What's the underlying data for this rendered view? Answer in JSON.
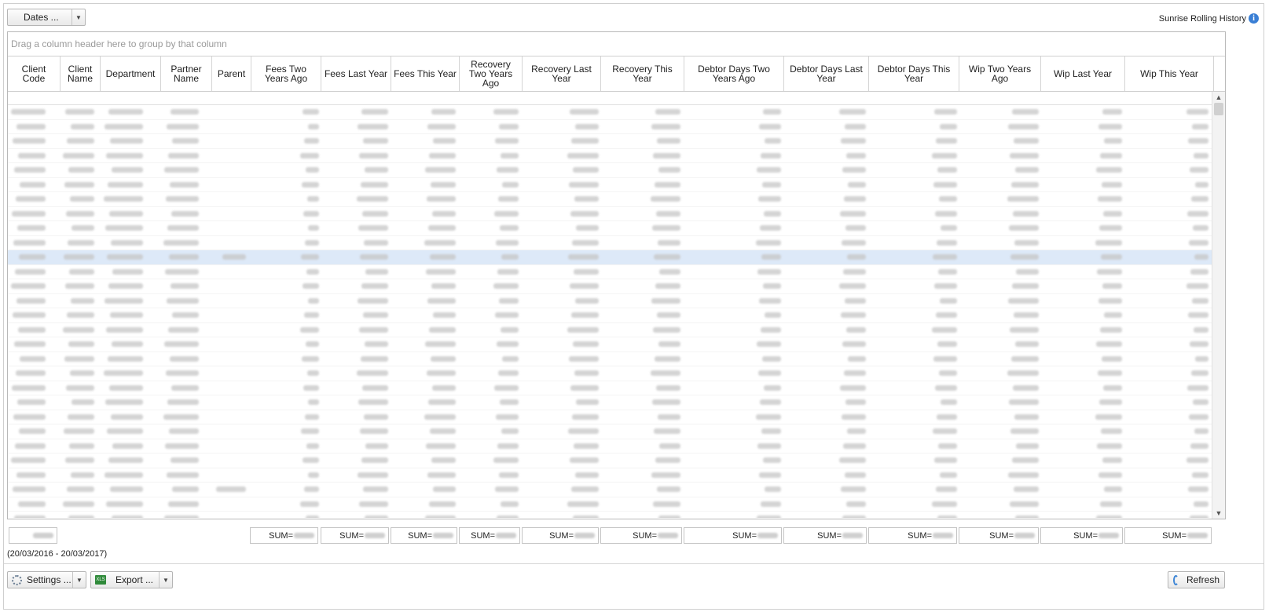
{
  "toolbar": {
    "dates_label": "Dates ...",
    "report_title": "Sunrise Rolling History",
    "info_icon": "i"
  },
  "grid": {
    "group_panel_text": "Drag a column header here to group by that column",
    "columns": [
      "Client Code",
      "Client Name",
      "Department",
      "Partner Name",
      "Parent",
      "Fees Two Years Ago",
      "Fees Last Year",
      "Fees This Year",
      "Recovery Two Years Ago",
      "Recovery Last Year",
      "Recovery This Year",
      "Debtor Days Two Years Ago",
      "Debtor Days Last Year",
      "Debtor Days This Year",
      "Wip Two Years Ago",
      "Wip Last Year",
      "Wip This Year"
    ],
    "selected_row_index": 10,
    "footer_sums": [
      "SUM=",
      "SUM=",
      "SUM=",
      "SUM=",
      "SUM=",
      "SUM=",
      "SUM=",
      "SUM=",
      "SUM=",
      "SUM=",
      "SUM=",
      "SUM="
    ]
  },
  "status": {
    "date_range": "(20/03/2016 - 20/03/2017)"
  },
  "bottom_bar": {
    "settings_label": "Settings ...",
    "export_label": "Export ...",
    "refresh_label": "Refresh",
    "export_icon_text": "XLS"
  }
}
